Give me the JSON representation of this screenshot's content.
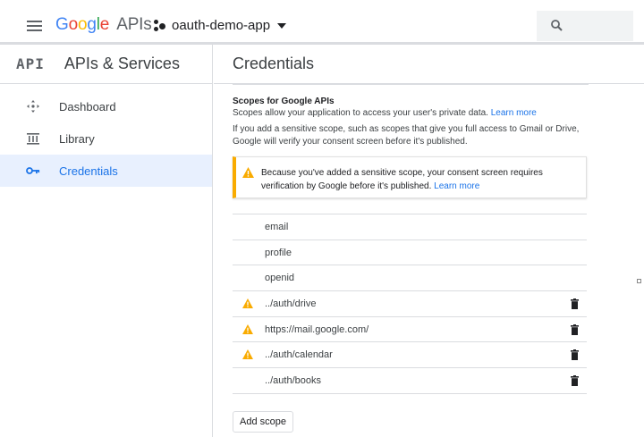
{
  "header": {
    "brand_google": [
      "G",
      "o",
      "o",
      "g",
      "l",
      "e"
    ],
    "brand_suffix": "APIs",
    "project_name": "oauth-demo-app"
  },
  "sidebar": {
    "logo": "API",
    "title": "APIs & Services",
    "items": [
      {
        "label": "Dashboard",
        "icon": "dashboard-icon",
        "active": false
      },
      {
        "label": "Library",
        "icon": "library-icon",
        "active": false
      },
      {
        "label": "Credentials",
        "icon": "key-icon",
        "active": true
      }
    ]
  },
  "main": {
    "title": "Credentials",
    "scopes_title": "Scopes for Google APIs",
    "scopes_desc": "Scopes allow your application to access your user's private data.",
    "learn_more": "Learn more",
    "sensitive_desc": "If you add a sensitive scope, such as scopes that give you full access to Gmail or Drive, Google will verify your consent screen before it's published.",
    "warning_text": "Because you've added a sensitive scope, your consent screen requires verification by Google before it's published.",
    "warning_link": "Learn more",
    "scopes": [
      {
        "scope": "email",
        "sensitive": false,
        "removable": false
      },
      {
        "scope": "profile",
        "sensitive": false,
        "removable": false
      },
      {
        "scope": "openid",
        "sensitive": false,
        "removable": false
      },
      {
        "scope": "../auth/drive",
        "sensitive": true,
        "removable": true
      },
      {
        "scope": "https://mail.google.com/",
        "sensitive": true,
        "removable": true
      },
      {
        "scope": "../auth/calendar",
        "sensitive": true,
        "removable": true
      },
      {
        "scope": "../auth/books",
        "sensitive": false,
        "removable": true
      }
    ],
    "add_scope_label": "Add scope"
  },
  "colors": {
    "google_blue": "#4285f4",
    "accent": "#1a73e8",
    "warning": "#f9ab00",
    "active_bg": "#e8f0fe"
  }
}
